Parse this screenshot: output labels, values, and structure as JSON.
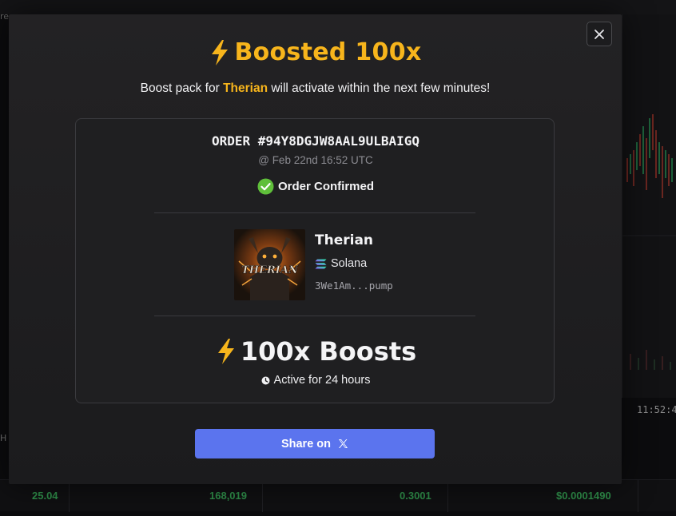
{
  "modal": {
    "title": "Boosted 100x",
    "subtitle_before": "Boost pack for ",
    "subtitle_token": "Therian",
    "subtitle_after": " will activate within the next few minutes!",
    "order_id": "ORDER #94Y8DGJW8AAL9ULBAIGQ",
    "order_time": "@ Feb 22nd 16:52 UTC",
    "status": "Order Confirmed",
    "token": {
      "name": "Therian",
      "image_text": "THERIAN",
      "chain": "Solana",
      "address": "3We1Am...pump"
    },
    "boosts": "100x Boosts",
    "duration": "Active for 24 hours",
    "share_label": "Share on",
    "close_icon": "close-icon"
  },
  "background": {
    "partial_text": "re",
    "left_letter": "H",
    "chart_time": "11:52:4",
    "table_row": [
      "25.04",
      "168,019",
      "0.3001",
      "$0.0001490"
    ]
  },
  "colors": {
    "accent": "#f7b51c",
    "share_button": "#5b74ee",
    "confirmed": "#5fbf3a",
    "positive": "#2f8f4a"
  }
}
